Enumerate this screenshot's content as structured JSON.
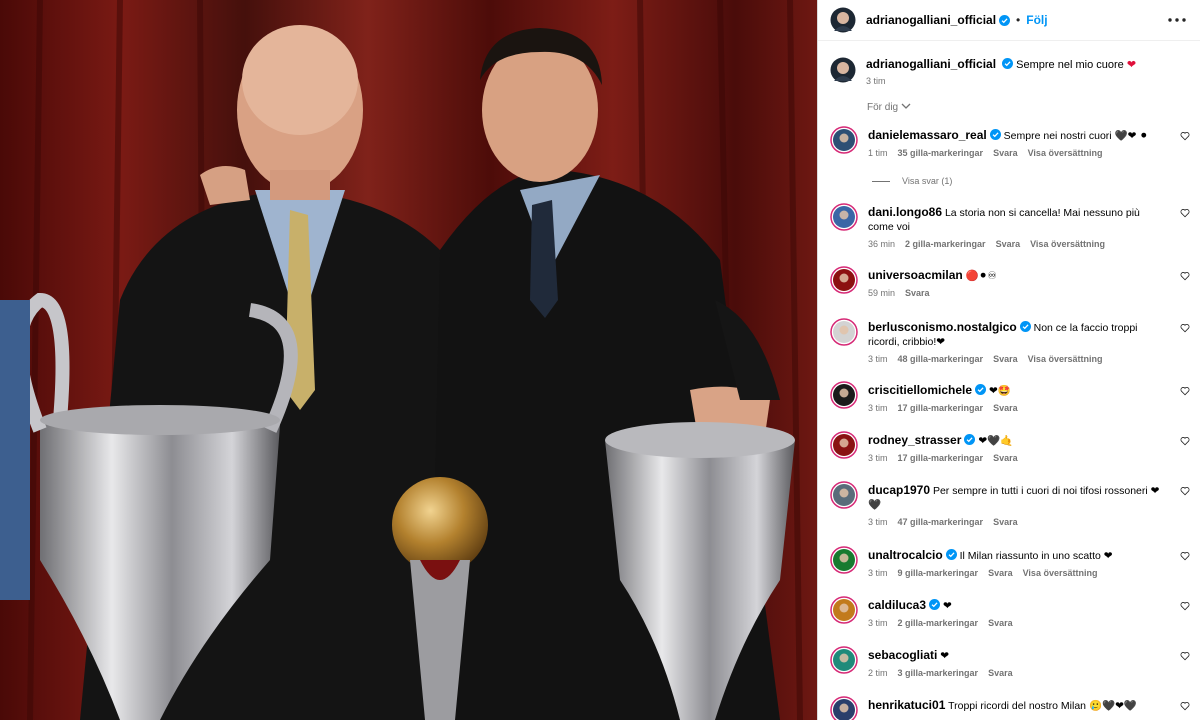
{
  "post": {
    "author": "adrianogalliani_official",
    "follow_label": "Följ",
    "separator": "•",
    "caption_text": "Sempre nel mio cuore",
    "caption_emoji": "❤",
    "caption_time": "3 tim",
    "for_you_label": "För dig"
  },
  "comments": [
    {
      "user": "danielemassaro_real",
      "verified": true,
      "text": "Sempre nei nostri cuori 🖤❤ ⚫",
      "time": "1 tim",
      "likes": "35 gilla-markeringar",
      "reply": "Svara",
      "translate": "Visa översättning",
      "view_replies": "Visa svar (1)",
      "avatar_color": "#2d4f74"
    },
    {
      "user": "dani.longo86",
      "verified": false,
      "text": "La storia non si cancella! Mai nessuno più come voi",
      "time": "36 min",
      "likes": "2 gilla-markeringar",
      "reply": "Svara",
      "translate": "Visa översättning",
      "avatar_color": "#3a66a6"
    },
    {
      "user": "universoacmilan",
      "verified": false,
      "text": "🔴⚫♾",
      "time": "59 min",
      "likes": "",
      "reply": "Svara",
      "translate": "",
      "avatar_color": "#8c1010"
    },
    {
      "user": "berlusconismo.nostalgico",
      "verified": true,
      "text": "Non ce la faccio troppi ricordi, cribbio!❤",
      "time": "3 tim",
      "likes": "48 gilla-markeringar",
      "reply": "Svara",
      "translate": "Visa översättning",
      "avatar_color": "#d3d3d3"
    },
    {
      "user": "criscitiellomichele",
      "verified": true,
      "text": "❤🤩",
      "time": "3 tim",
      "likes": "17 gilla-markeringar",
      "reply": "Svara",
      "translate": "",
      "avatar_color": "#1b1b1b"
    },
    {
      "user": "rodney_strasser",
      "verified": true,
      "text": "❤🖤🤙",
      "time": "3 tim",
      "likes": "17 gilla-markeringar",
      "reply": "Svara",
      "translate": "",
      "avatar_color": "#8a1313"
    },
    {
      "user": "ducap1970",
      "verified": false,
      "text": "Per sempre in tutti i cuori di noi tifosi rossoneri ❤🖤",
      "time": "3 tim",
      "likes": "47 gilla-markeringar",
      "reply": "Svara",
      "translate": "",
      "avatar_color": "#5a6c7a"
    },
    {
      "user": "unaltrocalcio",
      "verified": true,
      "text": "Il Milan riassunto in uno scatto ❤",
      "time": "3 tim",
      "likes": "9 gilla-markeringar",
      "reply": "Svara",
      "translate": "Visa översättning",
      "avatar_color": "#177a2f"
    },
    {
      "user": "caldiluca3",
      "verified": true,
      "text": "❤",
      "time": "3 tim",
      "likes": "2 gilla-markeringar",
      "reply": "Svara",
      "translate": "",
      "avatar_color": "#c27a1c"
    },
    {
      "user": "sebacogliati",
      "verified": false,
      "text": "❤",
      "time": "2 tim",
      "likes": "3 gilla-markeringar",
      "reply": "Svara",
      "translate": "",
      "avatar_color": "#1f8a7a"
    },
    {
      "user": "henrikatuci01",
      "verified": false,
      "text": "Troppi ricordi del nostro Milan 🥲🖤❤🖤",
      "time": "",
      "likes": "",
      "reply": "",
      "translate": "",
      "avatar_color": "#2a3e6b"
    }
  ]
}
